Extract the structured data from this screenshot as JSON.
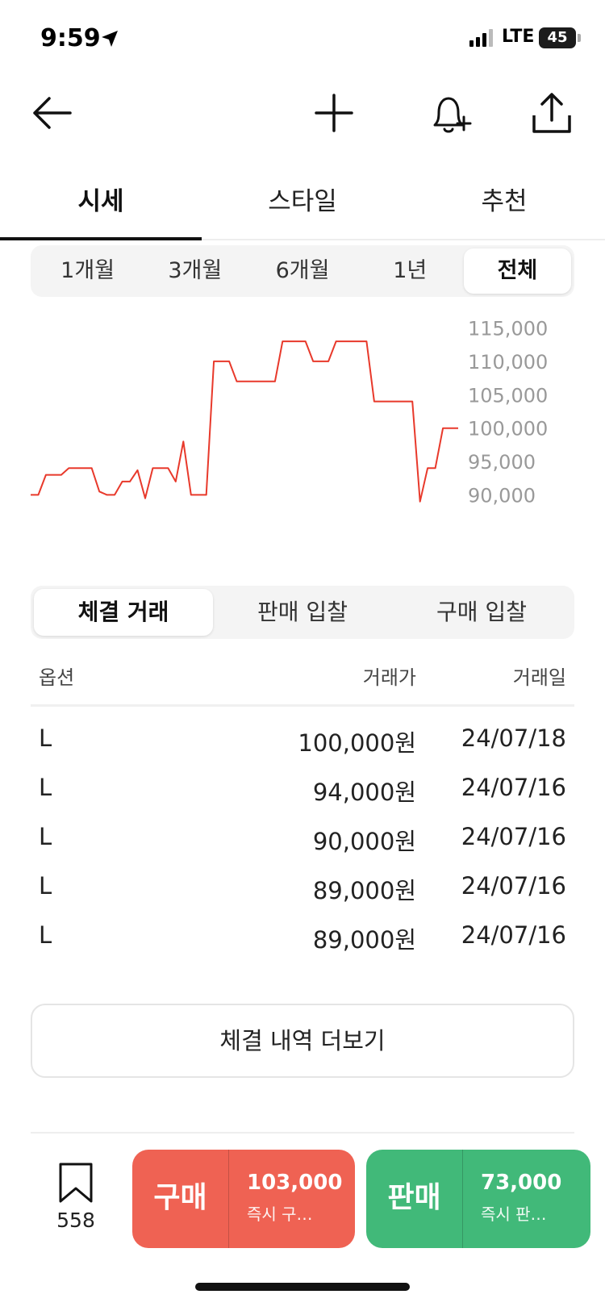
{
  "status_bar": {
    "time": "9:59",
    "network": "LTE",
    "battery": "45"
  },
  "toolbar": {
    "back_icon": "arrow-left-icon",
    "add_icon": "plus-icon",
    "alert_icon": "bell-plus-icon",
    "share_icon": "share-icon"
  },
  "tabs": [
    {
      "label": "시세",
      "active": true
    },
    {
      "label": "스타일",
      "active": false
    },
    {
      "label": "추천",
      "active": false
    }
  ],
  "periods": [
    {
      "label": "1개월",
      "active": false
    },
    {
      "label": "3개월",
      "active": false
    },
    {
      "label": "6개월",
      "active": false
    },
    {
      "label": "1년",
      "active": false
    },
    {
      "label": "전체",
      "active": true
    }
  ],
  "chart_data": {
    "type": "line",
    "line_color": "#e8392b",
    "ylim": [
      88000,
      117000
    ],
    "y_ticks": [
      "115,000",
      "110,000",
      "105,000",
      "100,000",
      "95,000",
      "90,000"
    ],
    "y_tick_values": [
      115000,
      110000,
      105000,
      100000,
      95000,
      90000
    ],
    "values": [
      90000,
      90000,
      93000,
      93000,
      93000,
      94000,
      94000,
      94000,
      94000,
      90500,
      90000,
      90000,
      92000,
      92000,
      93700,
      89500,
      94000,
      94000,
      94000,
      92000,
      98000,
      90000,
      90000,
      90000,
      110000,
      110000,
      110000,
      107000,
      107000,
      107000,
      107000,
      107000,
      107000,
      113000,
      113000,
      113000,
      113000,
      110000,
      110000,
      110000,
      113000,
      113000,
      113000,
      113000,
      113000,
      104000,
      104000,
      104000,
      104000,
      104000,
      104000,
      89000,
      94000,
      94000,
      100000,
      100000,
      100000
    ],
    "x": [
      0,
      1,
      2,
      3,
      4,
      5,
      6,
      7,
      8,
      9,
      10,
      11,
      12,
      13,
      14,
      15,
      16,
      17,
      18,
      19,
      20,
      21,
      22,
      23,
      24,
      25,
      26,
      27,
      28,
      29,
      30,
      31,
      32,
      33,
      34,
      35,
      36,
      37,
      38,
      39,
      40,
      41,
      42,
      43,
      44,
      45,
      46,
      47,
      48,
      49,
      50,
      51,
      52,
      53,
      54,
      55,
      56
    ]
  },
  "trade_tabs": [
    {
      "label": "체결 거래",
      "active": true
    },
    {
      "label": "판매 입찰",
      "active": false
    },
    {
      "label": "구매 입찰",
      "active": false
    }
  ],
  "table": {
    "headers": {
      "option": "옵션",
      "price": "거래가",
      "date": "거래일"
    },
    "rows": [
      {
        "option": "L",
        "price": "100,000원",
        "date": "24/07/18"
      },
      {
        "option": "L",
        "price": "94,000원",
        "date": "24/07/16"
      },
      {
        "option": "L",
        "price": "90,000원",
        "date": "24/07/16"
      },
      {
        "option": "L",
        "price": "89,000원",
        "date": "24/07/16"
      },
      {
        "option": "L",
        "price": "89,000원",
        "date": "24/07/16"
      }
    ]
  },
  "more_button": "체결 내역 더보기",
  "bottom": {
    "bookmark_count": "558",
    "buy": {
      "label": "구매",
      "price": "103,000",
      "sub": "즉시 구…",
      "color": "#ef6253"
    },
    "sell": {
      "label": "판매",
      "price": "73,000",
      "sub": "즉시 판…",
      "color": "#41b979"
    }
  }
}
